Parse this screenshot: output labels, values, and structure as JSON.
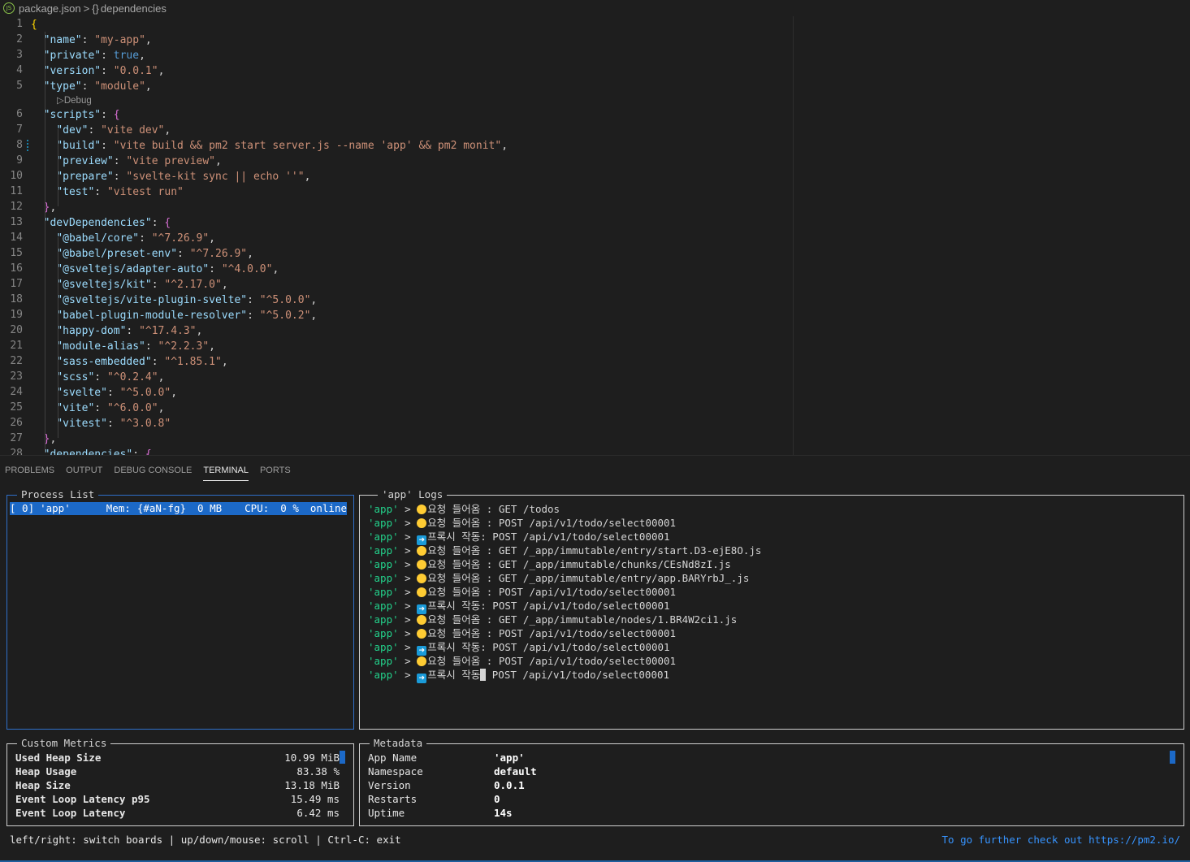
{
  "breadcrumb": {
    "file_icon_text": "JS",
    "file": "package.json",
    "separator": ">",
    "braces": "{}",
    "symbol": "dependencies"
  },
  "editor": {
    "codelens": "▷Debug",
    "lines": [
      {
        "n": "1",
        "tokens": [
          {
            "t": "{",
            "c": "b1"
          }
        ]
      },
      {
        "n": "2",
        "tokens": [
          {
            "t": "  "
          },
          {
            "t": "\"name\"",
            "c": "k"
          },
          {
            "t": ": ",
            "c": "p"
          },
          {
            "t": "\"my-app\"",
            "c": "s"
          },
          {
            "t": ",",
            "c": "p"
          }
        ]
      },
      {
        "n": "3",
        "tokens": [
          {
            "t": "  "
          },
          {
            "t": "\"private\"",
            "c": "k"
          },
          {
            "t": ": ",
            "c": "p"
          },
          {
            "t": "true",
            "c": "kw"
          },
          {
            "t": ",",
            "c": "p"
          }
        ]
      },
      {
        "n": "4",
        "tokens": [
          {
            "t": "  "
          },
          {
            "t": "\"version\"",
            "c": "k"
          },
          {
            "t": ": ",
            "c": "p"
          },
          {
            "t": "\"0.0.1\"",
            "c": "s"
          },
          {
            "t": ",",
            "c": "p"
          }
        ]
      },
      {
        "n": "5",
        "tokens": [
          {
            "t": "  "
          },
          {
            "t": "\"type\"",
            "c": "k"
          },
          {
            "t": ": ",
            "c": "p"
          },
          {
            "t": "\"module\"",
            "c": "s"
          },
          {
            "t": ",",
            "c": "p"
          }
        ]
      },
      {
        "n": "6",
        "tokens": [
          {
            "t": "  "
          },
          {
            "t": "\"scripts\"",
            "c": "k"
          },
          {
            "t": ": ",
            "c": "p"
          },
          {
            "t": "{",
            "c": "b2"
          }
        ]
      },
      {
        "n": "7",
        "tokens": [
          {
            "t": "    "
          },
          {
            "t": "\"dev\"",
            "c": "k"
          },
          {
            "t": ": ",
            "c": "p"
          },
          {
            "t": "\"vite dev\"",
            "c": "s"
          },
          {
            "t": ",",
            "c": "p"
          }
        ]
      },
      {
        "n": "8",
        "tokens": [
          {
            "t": "    "
          },
          {
            "t": "\"build\"",
            "c": "k"
          },
          {
            "t": ": ",
            "c": "p"
          },
          {
            "t": "\"vite build && pm2 start server.js --name 'app' && pm2 monit\"",
            "c": "s"
          },
          {
            "t": ",",
            "c": "p"
          }
        ]
      },
      {
        "n": "9",
        "tokens": [
          {
            "t": "    "
          },
          {
            "t": "\"preview\"",
            "c": "k"
          },
          {
            "t": ": ",
            "c": "p"
          },
          {
            "t": "\"vite preview\"",
            "c": "s"
          },
          {
            "t": ",",
            "c": "p"
          }
        ]
      },
      {
        "n": "10",
        "tokens": [
          {
            "t": "    "
          },
          {
            "t": "\"prepare\"",
            "c": "k"
          },
          {
            "t": ": ",
            "c": "p"
          },
          {
            "t": "\"svelte-kit sync || echo ''\"",
            "c": "s"
          },
          {
            "t": ",",
            "c": "p"
          }
        ]
      },
      {
        "n": "11",
        "tokens": [
          {
            "t": "    "
          },
          {
            "t": "\"test\"",
            "c": "k"
          },
          {
            "t": ": ",
            "c": "p"
          },
          {
            "t": "\"vitest run\"",
            "c": "s"
          }
        ]
      },
      {
        "n": "12",
        "tokens": [
          {
            "t": "  "
          },
          {
            "t": "}",
            "c": "b2"
          },
          {
            "t": ",",
            "c": "p"
          }
        ]
      },
      {
        "n": "13",
        "tokens": [
          {
            "t": "  "
          },
          {
            "t": "\"devDependencies\"",
            "c": "k"
          },
          {
            "t": ": ",
            "c": "p"
          },
          {
            "t": "{",
            "c": "b2"
          }
        ]
      },
      {
        "n": "14",
        "tokens": [
          {
            "t": "    "
          },
          {
            "t": "\"@babel/core\"",
            "c": "k"
          },
          {
            "t": ": ",
            "c": "p"
          },
          {
            "t": "\"^7.26.9\"",
            "c": "s"
          },
          {
            "t": ",",
            "c": "p"
          }
        ]
      },
      {
        "n": "15",
        "tokens": [
          {
            "t": "    "
          },
          {
            "t": "\"@babel/preset-env\"",
            "c": "k"
          },
          {
            "t": ": ",
            "c": "p"
          },
          {
            "t": "\"^7.26.9\"",
            "c": "s"
          },
          {
            "t": ",",
            "c": "p"
          }
        ]
      },
      {
        "n": "16",
        "tokens": [
          {
            "t": "    "
          },
          {
            "t": "\"@sveltejs/adapter-auto\"",
            "c": "k"
          },
          {
            "t": ": ",
            "c": "p"
          },
          {
            "t": "\"^4.0.0\"",
            "c": "s"
          },
          {
            "t": ",",
            "c": "p"
          }
        ]
      },
      {
        "n": "17",
        "tokens": [
          {
            "t": "    "
          },
          {
            "t": "\"@sveltejs/kit\"",
            "c": "k"
          },
          {
            "t": ": ",
            "c": "p"
          },
          {
            "t": "\"^2.17.0\"",
            "c": "s"
          },
          {
            "t": ",",
            "c": "p"
          }
        ]
      },
      {
        "n": "18",
        "tokens": [
          {
            "t": "    "
          },
          {
            "t": "\"@sveltejs/vite-plugin-svelte\"",
            "c": "k"
          },
          {
            "t": ": ",
            "c": "p"
          },
          {
            "t": "\"^5.0.0\"",
            "c": "s"
          },
          {
            "t": ",",
            "c": "p"
          }
        ]
      },
      {
        "n": "19",
        "tokens": [
          {
            "t": "    "
          },
          {
            "t": "\"babel-plugin-module-resolver\"",
            "c": "k"
          },
          {
            "t": ": ",
            "c": "p"
          },
          {
            "t": "\"^5.0.2\"",
            "c": "s"
          },
          {
            "t": ",",
            "c": "p"
          }
        ]
      },
      {
        "n": "20",
        "tokens": [
          {
            "t": "    "
          },
          {
            "t": "\"happy-dom\"",
            "c": "k"
          },
          {
            "t": ": ",
            "c": "p"
          },
          {
            "t": "\"^17.4.3\"",
            "c": "s"
          },
          {
            "t": ",",
            "c": "p"
          }
        ]
      },
      {
        "n": "21",
        "tokens": [
          {
            "t": "    "
          },
          {
            "t": "\"module-alias\"",
            "c": "k"
          },
          {
            "t": ": ",
            "c": "p"
          },
          {
            "t": "\"^2.2.3\"",
            "c": "s"
          },
          {
            "t": ",",
            "c": "p"
          }
        ]
      },
      {
        "n": "22",
        "tokens": [
          {
            "t": "    "
          },
          {
            "t": "\"sass-embedded\"",
            "c": "k"
          },
          {
            "t": ": ",
            "c": "p"
          },
          {
            "t": "\"^1.85.1\"",
            "c": "s"
          },
          {
            "t": ",",
            "c": "p"
          }
        ]
      },
      {
        "n": "23",
        "tokens": [
          {
            "t": "    "
          },
          {
            "t": "\"scss\"",
            "c": "k"
          },
          {
            "t": ": ",
            "c": "p"
          },
          {
            "t": "\"^0.2.4\"",
            "c": "s"
          },
          {
            "t": ",",
            "c": "p"
          }
        ]
      },
      {
        "n": "24",
        "tokens": [
          {
            "t": "    "
          },
          {
            "t": "\"svelte\"",
            "c": "k"
          },
          {
            "t": ": ",
            "c": "p"
          },
          {
            "t": "\"^5.0.0\"",
            "c": "s"
          },
          {
            "t": ",",
            "c": "p"
          }
        ]
      },
      {
        "n": "25",
        "tokens": [
          {
            "t": "    "
          },
          {
            "t": "\"vite\"",
            "c": "k"
          },
          {
            "t": ": ",
            "c": "p"
          },
          {
            "t": "\"^6.0.0\"",
            "c": "s"
          },
          {
            "t": ",",
            "c": "p"
          }
        ]
      },
      {
        "n": "26",
        "tokens": [
          {
            "t": "    "
          },
          {
            "t": "\"vitest\"",
            "c": "k"
          },
          {
            "t": ": ",
            "c": "p"
          },
          {
            "t": "\"^3.0.8\"",
            "c": "s"
          }
        ]
      },
      {
        "n": "27",
        "tokens": [
          {
            "t": "  "
          },
          {
            "t": "}",
            "c": "b2"
          },
          {
            "t": ",",
            "c": "p"
          }
        ]
      },
      {
        "n": "28",
        "tokens": [
          {
            "t": "  "
          },
          {
            "t": "\"dependencies\"",
            "c": "k"
          },
          {
            "t": ": ",
            "c": "p"
          },
          {
            "t": "{",
            "c": "b2"
          }
        ]
      }
    ]
  },
  "panel": {
    "tabs": [
      {
        "label": "PROBLEMS",
        "active": false
      },
      {
        "label": "OUTPUT",
        "active": false
      },
      {
        "label": "DEBUG CONSOLE",
        "active": false
      },
      {
        "label": "TERMINAL",
        "active": true
      },
      {
        "label": "PORTS",
        "active": false
      }
    ]
  },
  "pm2": {
    "process_list": {
      "title": "Process List",
      "row": {
        "id": "[ 0]",
        "name": "'app'",
        "mem_label": "Mem:",
        "mem_value": "{#aN-fg}",
        "mem_size": "0 MB",
        "cpu_label": "CPU:",
        "cpu_value": "0 %",
        "status": "online"
      }
    },
    "logs": {
      "title": "'app' Logs",
      "lines": [
        {
          "app": "'app'",
          "sep": " > ",
          "icon": "dot",
          "kind": "요청 들어옴 : ",
          "msg": "GET /todos"
        },
        {
          "app": "'app'",
          "sep": " > ",
          "icon": "dot",
          "kind": "요청 들어옴 : ",
          "msg": "POST /api/v1/todo/select00001"
        },
        {
          "app": "'app'",
          "sep": " > ",
          "icon": "arrow",
          "kind": "프록시 작동: ",
          "msg": "POST /api/v1/todo/select00001"
        },
        {
          "app": "'app'",
          "sep": " > ",
          "icon": "dot",
          "kind": "요청 들어옴 : ",
          "msg": "GET /_app/immutable/entry/start.D3-ejE8O.js"
        },
        {
          "app": "'app'",
          "sep": " > ",
          "icon": "dot",
          "kind": "요청 들어옴 : ",
          "msg": "GET /_app/immutable/chunks/CEsNd8zI.js"
        },
        {
          "app": "'app'",
          "sep": " > ",
          "icon": "dot",
          "kind": "요청 들어옴 : ",
          "msg": "GET /_app/immutable/entry/app.BARYrbJ_.js"
        },
        {
          "app": "'app'",
          "sep": " > ",
          "icon": "dot",
          "kind": "요청 들어옴 : ",
          "msg": "POST /api/v1/todo/select00001"
        },
        {
          "app": "'app'",
          "sep": " > ",
          "icon": "arrow",
          "kind": "프록시 작동: ",
          "msg": "POST /api/v1/todo/select00001"
        },
        {
          "app": "'app'",
          "sep": " > ",
          "icon": "dot",
          "kind": "요청 들어옴 : ",
          "msg": "GET /_app/immutable/nodes/1.BR4W2ci1.js"
        },
        {
          "app": "'app'",
          "sep": " > ",
          "icon": "dot",
          "kind": "요청 들어옴 : ",
          "msg": "POST /api/v1/todo/select00001"
        },
        {
          "app": "'app'",
          "sep": " > ",
          "icon": "arrow",
          "kind": "프록시 작동: ",
          "msg": "POST /api/v1/todo/select00001"
        },
        {
          "app": "'app'",
          "sep": " > ",
          "icon": "dot",
          "kind": "요청 들어옴 : ",
          "msg": "POST /api/v1/todo/select00001"
        },
        {
          "app": "'app'",
          "sep": " > ",
          "icon": "arrow",
          "kind": "프록시 작동",
          "msg": " POST /api/v1/todo/select00001",
          "cursor": true
        }
      ]
    },
    "custom_metrics": {
      "title": "Custom Metrics",
      "rows": [
        {
          "label": "Used Heap Size",
          "value": "10.99 MiB"
        },
        {
          "label": "Heap Usage",
          "value": "83.38 %"
        },
        {
          "label": "Heap Size",
          "value": "13.18 MiB"
        },
        {
          "label": "Event Loop Latency p95",
          "value": "15.49 ms"
        },
        {
          "label": "Event Loop Latency",
          "value": "6.42 ms"
        }
      ]
    },
    "metadata": {
      "title": "Metadata",
      "rows": [
        {
          "label": "App Name",
          "value": "'app'"
        },
        {
          "label": "Namespace",
          "value": "default"
        },
        {
          "label": "Version",
          "value": "0.0.1"
        },
        {
          "label": "Restarts",
          "value": "0"
        },
        {
          "label": "Uptime",
          "value": "14s"
        }
      ]
    },
    "footer_left": "left/right: switch boards | up/down/mouse: scroll | Ctrl-C: exit",
    "footer_right": "To go further check out https://pm2.io/"
  }
}
